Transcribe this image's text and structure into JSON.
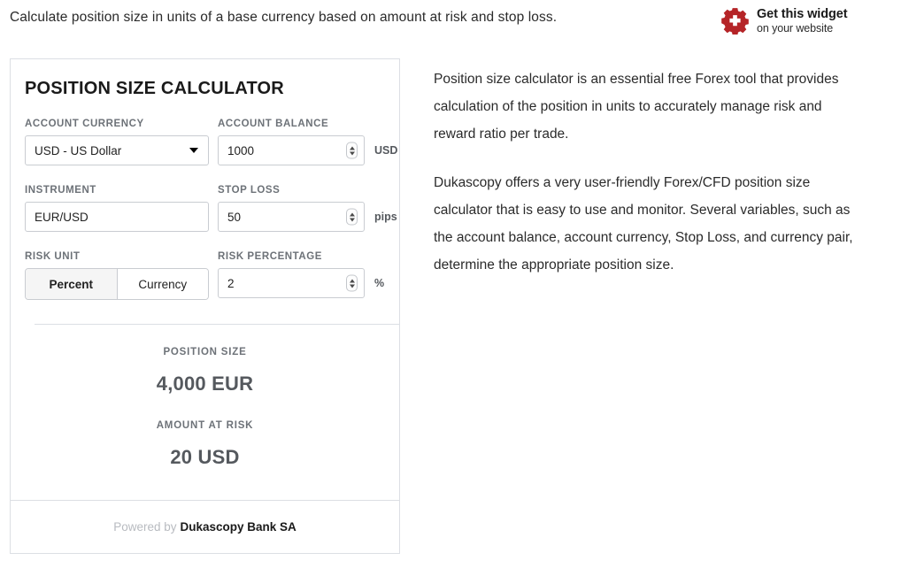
{
  "header": {
    "intro": "Calculate position size in units of a base currency based on amount at risk and stop loss.",
    "widget_badge": {
      "icon": "gear-icon",
      "line1": "Get this widget",
      "line2": "on your website",
      "icon_color": "#b52427"
    }
  },
  "calculator": {
    "title": "POSITION SIZE CALCULATOR",
    "fields": {
      "account_currency": {
        "label": "ACCOUNT CURRENCY",
        "value": "USD - US Dollar",
        "icon": "chevron-down-icon"
      },
      "account_balance": {
        "label": "ACCOUNT BALANCE",
        "value": "1000",
        "unit": "USD"
      },
      "instrument": {
        "label": "INSTRUMENT",
        "value": "EUR/USD"
      },
      "stop_loss": {
        "label": "STOP LOSS",
        "value": "50",
        "unit": "pips"
      },
      "risk_unit": {
        "label": "RISK UNIT",
        "options": [
          "Percent",
          "Currency"
        ],
        "selected": "Percent"
      },
      "risk_percentage": {
        "label": "RISK PERCENTAGE",
        "value": "2",
        "unit": "%"
      }
    },
    "results": {
      "position_size_label": "POSITION SIZE",
      "position_size_value": "4,000 EUR",
      "amount_at_risk_label": "AMOUNT AT RISK",
      "amount_at_risk_value": "20 USD"
    },
    "footer": {
      "powered_by": "Powered by",
      "brand": "Dukascopy Bank SA"
    }
  },
  "description": {
    "paragraph1": "Position size calculator is an essential free Forex tool that provides calculation of the position in units to accurately manage risk and reward ratio per trade.",
    "paragraph2": "Dukascopy offers a very user-friendly Forex/CFD position size calculator that is easy to use and monitor. Several variables, such as the account balance, account currency, Stop Loss, and currency pair, determine the appropriate position size."
  }
}
